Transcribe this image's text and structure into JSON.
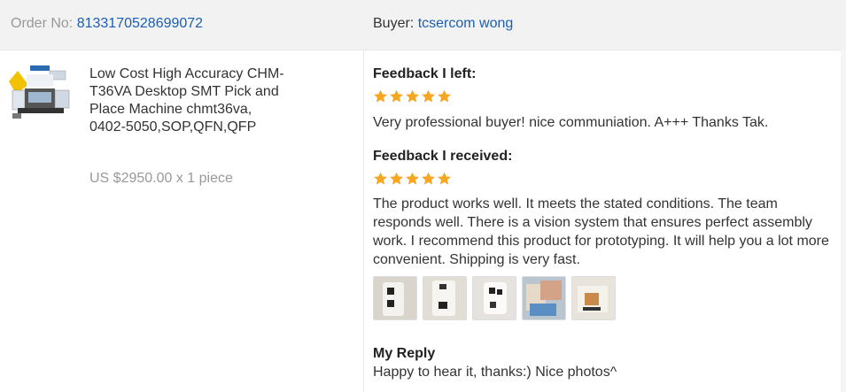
{
  "header": {
    "order_label": "Order No:",
    "order_number": "8133170528699072",
    "buyer_label": "Buyer:",
    "buyer_name": "tcsercom wong"
  },
  "product": {
    "title": "Low Cost High Accuracy CHM-T36VA Desktop SMT Pick and Place Machine chmt36va, 0402-5050,SOP,QFN,QFP",
    "price_line": "US $2950.00 x 1 piece",
    "thumbnail_icon": "product-thumbnail"
  },
  "feedback_left": {
    "heading": "Feedback I left:",
    "stars": 5,
    "text": "Very professional buyer! nice communiation. A+++ Thanks Tak."
  },
  "feedback_received": {
    "heading": "Feedback I received:",
    "stars": 5,
    "text": "The product works well. It meets the stated conditions. The team responds well. There is a vision system that ensures perfect assembly work. I recommend this product for prototyping. It will help you a lot more convenient. Shipping is very fast.",
    "photos": [
      "photo-1",
      "photo-2",
      "photo-3",
      "photo-4",
      "photo-5"
    ]
  },
  "reply": {
    "heading": "My Reply",
    "text": "Happy to hear it, thanks:) Nice photos^"
  },
  "colors": {
    "star": "#f5a623",
    "link": "#1a5fb4",
    "header_bg": "#f2f2f2"
  }
}
